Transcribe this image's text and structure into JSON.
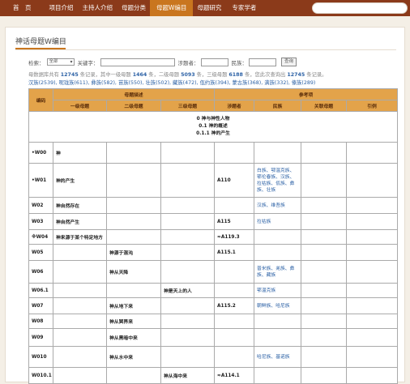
{
  "nav": {
    "items": [
      "首　页",
      "项目介绍",
      "主持人介绍",
      "母题分类",
      "母题W编目",
      "母题研究",
      "专家学者"
    ],
    "active_index": 4
  },
  "panel_title": "神话母题W编目",
  "search": {
    "label_select": "检索：",
    "select_value": "全部",
    "label_keyword": "关键字：",
    "label_source": "涉题者：",
    "label_ethnic": "民族：",
    "button": "查询"
  },
  "stat": {
    "p1": "母数据库共有",
    "total": "12745",
    "p2": "条记录，其中一级母题",
    "level1": "1464",
    "p3": "条，二级母题",
    "level2": "5093",
    "p4": "条，三级母题",
    "level3": "6188",
    "p5": "条，您此次查询出",
    "found": "12745",
    "p6": "条记录。",
    "ethnic": [
      "汉族(2539),",
      "呢珑族(611),",
      "彝族(582),",
      "苗族(550),",
      "壮族(502),",
      "藏族(472),",
      "佤约族(394),",
      "蒙古族(368),",
      "满族(332),",
      "傣族(289)"
    ]
  },
  "table": {
    "col_code": "编码",
    "group_desc": "母题描述",
    "group_ref": "参考项",
    "h_l1": "一级母题",
    "h_l2": "二级母题",
    "h_l3": "三级母题",
    "h_rel": "涉题者",
    "h_eth": "民族",
    "h_relm": "关联母题",
    "h_cite": "引例",
    "section": [
      "0 神与神性人物",
      "0.1 神的概述",
      "0.1.1 神的产生"
    ],
    "rows": [
      {
        "code": "•W00",
        "l1": "神",
        "l2": "",
        "l3": "",
        "rel": "",
        "eth": ""
      },
      {
        "code": "•W01",
        "l1": "神的产生",
        "l2": "",
        "l3": "",
        "rel": "A110",
        "eth": "白族、鄂温克族、鄂伦春族、汉族、拉祜族、佤族、彝族、壮族"
      },
      {
        "code": "W02",
        "l1": "神自然存在",
        "l2": "",
        "l3": "",
        "rel": "",
        "eth": "汉族、维吾族"
      },
      {
        "code": "W03",
        "l1": "神自然产生",
        "l2": "",
        "l3": "",
        "rel": "A115",
        "eth": "拉祜族"
      },
      {
        "code": "※W04",
        "l1": "神来源于某个特定地方",
        "l2": "",
        "l3": "",
        "rel": "≈A119.3",
        "eth": ""
      },
      {
        "code": "W05",
        "l1": "",
        "l2": "神源于混沌",
        "l3": "",
        "rel": "A115.1",
        "eth": ""
      },
      {
        "code": "W06",
        "l1": "",
        "l2": "神从天降",
        "l3": "",
        "rel": "",
        "eth": "普米族、羌族、彝族、藏族"
      },
      {
        "code": "W06.1",
        "l1": "",
        "l2": "",
        "l3": "神是天上的人",
        "rel": "",
        "eth": "鄂温克族"
      },
      {
        "code": "W07",
        "l1": "",
        "l2": "神从地下来",
        "l3": "",
        "rel": "A115.2",
        "eth": "朝鲜族、哈尼族"
      },
      {
        "code": "W08",
        "l1": "",
        "l2": "神从冥界来",
        "l3": "",
        "rel": "",
        "eth": ""
      },
      {
        "code": "W09",
        "l1": "",
        "l2": "神从黑暗中来",
        "l3": "",
        "rel": "",
        "eth": ""
      },
      {
        "code": "W010",
        "l1": "",
        "l2": "神从水中来",
        "l3": "",
        "rel": "",
        "eth": "哈尼族、基诺族"
      },
      {
        "code": "W010.1",
        "l1": "",
        "l2": "",
        "l3": "神从海中来",
        "rel": "≈A114.1",
        "eth": ""
      }
    ]
  },
  "colors": {
    "nav": "#8b3a1a",
    "active": "#c9761f",
    "header": "#e3a34a",
    "link": "#2d62a6"
  }
}
